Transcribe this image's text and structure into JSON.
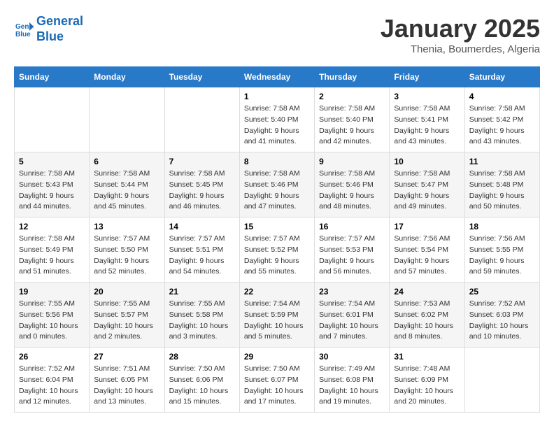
{
  "header": {
    "logo_line1": "General",
    "logo_line2": "Blue",
    "month": "January 2025",
    "location": "Thenia, Boumerdes, Algeria"
  },
  "weekdays": [
    "Sunday",
    "Monday",
    "Tuesday",
    "Wednesday",
    "Thursday",
    "Friday",
    "Saturday"
  ],
  "weeks": [
    [
      {
        "day": "",
        "info": ""
      },
      {
        "day": "",
        "info": ""
      },
      {
        "day": "",
        "info": ""
      },
      {
        "day": "1",
        "info": "Sunrise: 7:58 AM\nSunset: 5:40 PM\nDaylight: 9 hours\nand 41 minutes."
      },
      {
        "day": "2",
        "info": "Sunrise: 7:58 AM\nSunset: 5:40 PM\nDaylight: 9 hours\nand 42 minutes."
      },
      {
        "day": "3",
        "info": "Sunrise: 7:58 AM\nSunset: 5:41 PM\nDaylight: 9 hours\nand 43 minutes."
      },
      {
        "day": "4",
        "info": "Sunrise: 7:58 AM\nSunset: 5:42 PM\nDaylight: 9 hours\nand 43 minutes."
      }
    ],
    [
      {
        "day": "5",
        "info": "Sunrise: 7:58 AM\nSunset: 5:43 PM\nDaylight: 9 hours\nand 44 minutes."
      },
      {
        "day": "6",
        "info": "Sunrise: 7:58 AM\nSunset: 5:44 PM\nDaylight: 9 hours\nand 45 minutes."
      },
      {
        "day": "7",
        "info": "Sunrise: 7:58 AM\nSunset: 5:45 PM\nDaylight: 9 hours\nand 46 minutes."
      },
      {
        "day": "8",
        "info": "Sunrise: 7:58 AM\nSunset: 5:46 PM\nDaylight: 9 hours\nand 47 minutes."
      },
      {
        "day": "9",
        "info": "Sunrise: 7:58 AM\nSunset: 5:46 PM\nDaylight: 9 hours\nand 48 minutes."
      },
      {
        "day": "10",
        "info": "Sunrise: 7:58 AM\nSunset: 5:47 PM\nDaylight: 9 hours\nand 49 minutes."
      },
      {
        "day": "11",
        "info": "Sunrise: 7:58 AM\nSunset: 5:48 PM\nDaylight: 9 hours\nand 50 minutes."
      }
    ],
    [
      {
        "day": "12",
        "info": "Sunrise: 7:58 AM\nSunset: 5:49 PM\nDaylight: 9 hours\nand 51 minutes."
      },
      {
        "day": "13",
        "info": "Sunrise: 7:57 AM\nSunset: 5:50 PM\nDaylight: 9 hours\nand 52 minutes."
      },
      {
        "day": "14",
        "info": "Sunrise: 7:57 AM\nSunset: 5:51 PM\nDaylight: 9 hours\nand 54 minutes."
      },
      {
        "day": "15",
        "info": "Sunrise: 7:57 AM\nSunset: 5:52 PM\nDaylight: 9 hours\nand 55 minutes."
      },
      {
        "day": "16",
        "info": "Sunrise: 7:57 AM\nSunset: 5:53 PM\nDaylight: 9 hours\nand 56 minutes."
      },
      {
        "day": "17",
        "info": "Sunrise: 7:56 AM\nSunset: 5:54 PM\nDaylight: 9 hours\nand 57 minutes."
      },
      {
        "day": "18",
        "info": "Sunrise: 7:56 AM\nSunset: 5:55 PM\nDaylight: 9 hours\nand 59 minutes."
      }
    ],
    [
      {
        "day": "19",
        "info": "Sunrise: 7:55 AM\nSunset: 5:56 PM\nDaylight: 10 hours\nand 0 minutes."
      },
      {
        "day": "20",
        "info": "Sunrise: 7:55 AM\nSunset: 5:57 PM\nDaylight: 10 hours\nand 2 minutes."
      },
      {
        "day": "21",
        "info": "Sunrise: 7:55 AM\nSunset: 5:58 PM\nDaylight: 10 hours\nand 3 minutes."
      },
      {
        "day": "22",
        "info": "Sunrise: 7:54 AM\nSunset: 5:59 PM\nDaylight: 10 hours\nand 5 minutes."
      },
      {
        "day": "23",
        "info": "Sunrise: 7:54 AM\nSunset: 6:01 PM\nDaylight: 10 hours\nand 7 minutes."
      },
      {
        "day": "24",
        "info": "Sunrise: 7:53 AM\nSunset: 6:02 PM\nDaylight: 10 hours\nand 8 minutes."
      },
      {
        "day": "25",
        "info": "Sunrise: 7:52 AM\nSunset: 6:03 PM\nDaylight: 10 hours\nand 10 minutes."
      }
    ],
    [
      {
        "day": "26",
        "info": "Sunrise: 7:52 AM\nSunset: 6:04 PM\nDaylight: 10 hours\nand 12 minutes."
      },
      {
        "day": "27",
        "info": "Sunrise: 7:51 AM\nSunset: 6:05 PM\nDaylight: 10 hours\nand 13 minutes."
      },
      {
        "day": "28",
        "info": "Sunrise: 7:50 AM\nSunset: 6:06 PM\nDaylight: 10 hours\nand 15 minutes."
      },
      {
        "day": "29",
        "info": "Sunrise: 7:50 AM\nSunset: 6:07 PM\nDaylight: 10 hours\nand 17 minutes."
      },
      {
        "day": "30",
        "info": "Sunrise: 7:49 AM\nSunset: 6:08 PM\nDaylight: 10 hours\nand 19 minutes."
      },
      {
        "day": "31",
        "info": "Sunrise: 7:48 AM\nSunset: 6:09 PM\nDaylight: 10 hours\nand 20 minutes."
      },
      {
        "day": "",
        "info": ""
      }
    ]
  ]
}
